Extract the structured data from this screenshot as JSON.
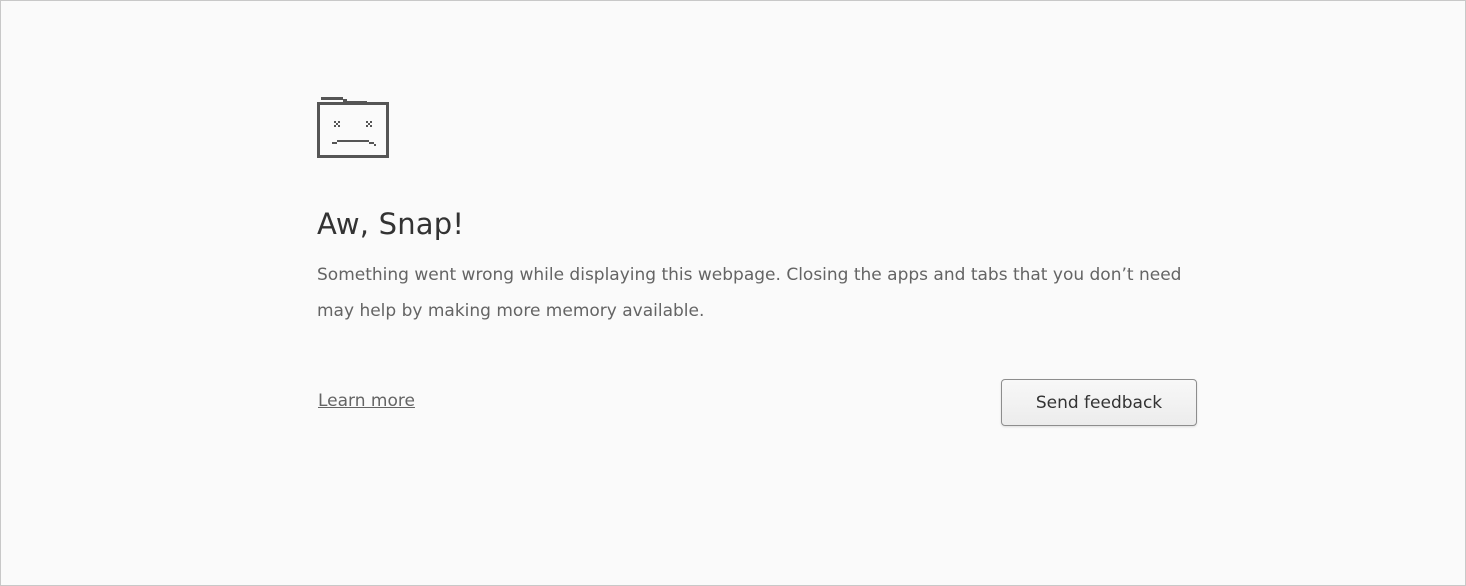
{
  "error_page": {
    "icon": "sad-tab-icon",
    "title": "Aw, Snap!",
    "message": "Something went wrong while displaying this webpage. Closing the apps and tabs that you don’t need may help by making more memory available.",
    "learn_more_label": "Learn more",
    "send_feedback_label": "Send feedback"
  },
  "colors": {
    "background": "#fafafa",
    "title": "#333333",
    "text": "#646464",
    "icon": "#555555"
  }
}
